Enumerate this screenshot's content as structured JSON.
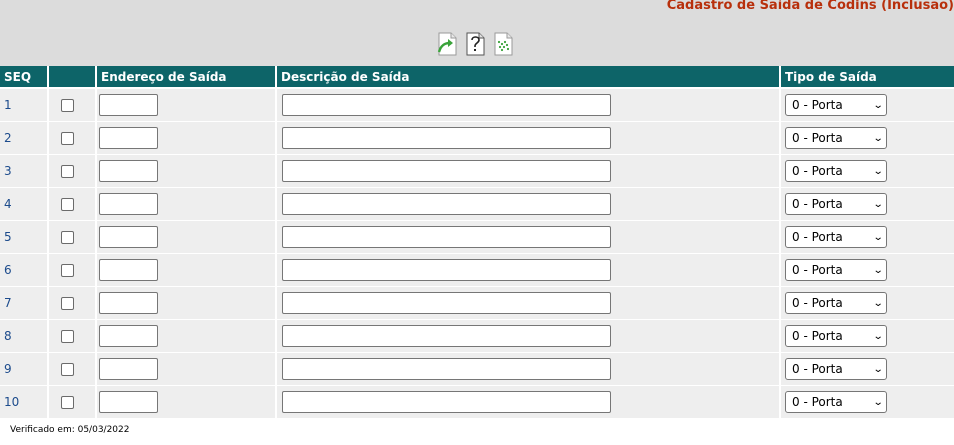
{
  "header": {
    "title": "Cadastro de Saída de Codins (Inclusão)"
  },
  "toolbar": {
    "buttons": [
      {
        "name": "confirm-button",
        "icon": "page-arrow-icon"
      },
      {
        "name": "help-button",
        "icon": "page-question-icon"
      },
      {
        "name": "clear-button",
        "icon": "page-sparkle-icon"
      }
    ]
  },
  "table": {
    "columns": {
      "seq": "SEQ",
      "check": "",
      "address": "Endereço de Saída",
      "description": "Descrição de Saída",
      "type": "Tipo de Saída"
    },
    "rows": [
      {
        "seq": "1",
        "address": "",
        "description": "",
        "type": "0 - Porta"
      },
      {
        "seq": "2",
        "address": "",
        "description": "",
        "type": "0 - Porta"
      },
      {
        "seq": "3",
        "address": "",
        "description": "",
        "type": "0 - Porta"
      },
      {
        "seq": "4",
        "address": "",
        "description": "",
        "type": "0 - Porta"
      },
      {
        "seq": "5",
        "address": "",
        "description": "",
        "type": "0 - Porta"
      },
      {
        "seq": "6",
        "address": "",
        "description": "",
        "type": "0 - Porta"
      },
      {
        "seq": "7",
        "address": "",
        "description": "",
        "type": "0 - Porta"
      },
      {
        "seq": "8",
        "address": "",
        "description": "",
        "type": "0 - Porta"
      },
      {
        "seq": "9",
        "address": "",
        "description": "",
        "type": "0 - Porta"
      },
      {
        "seq": "10",
        "address": "",
        "description": "",
        "type": "0 - Porta"
      }
    ]
  },
  "footer": {
    "verified": "Verificado em: 05/03/2022"
  },
  "colors": {
    "header_bg": "#0d6468",
    "title": "#b8300c",
    "row_bg": "#eeeeee",
    "topbar_bg": "#dcdcdc",
    "seq_link": "#1c4b8c"
  }
}
